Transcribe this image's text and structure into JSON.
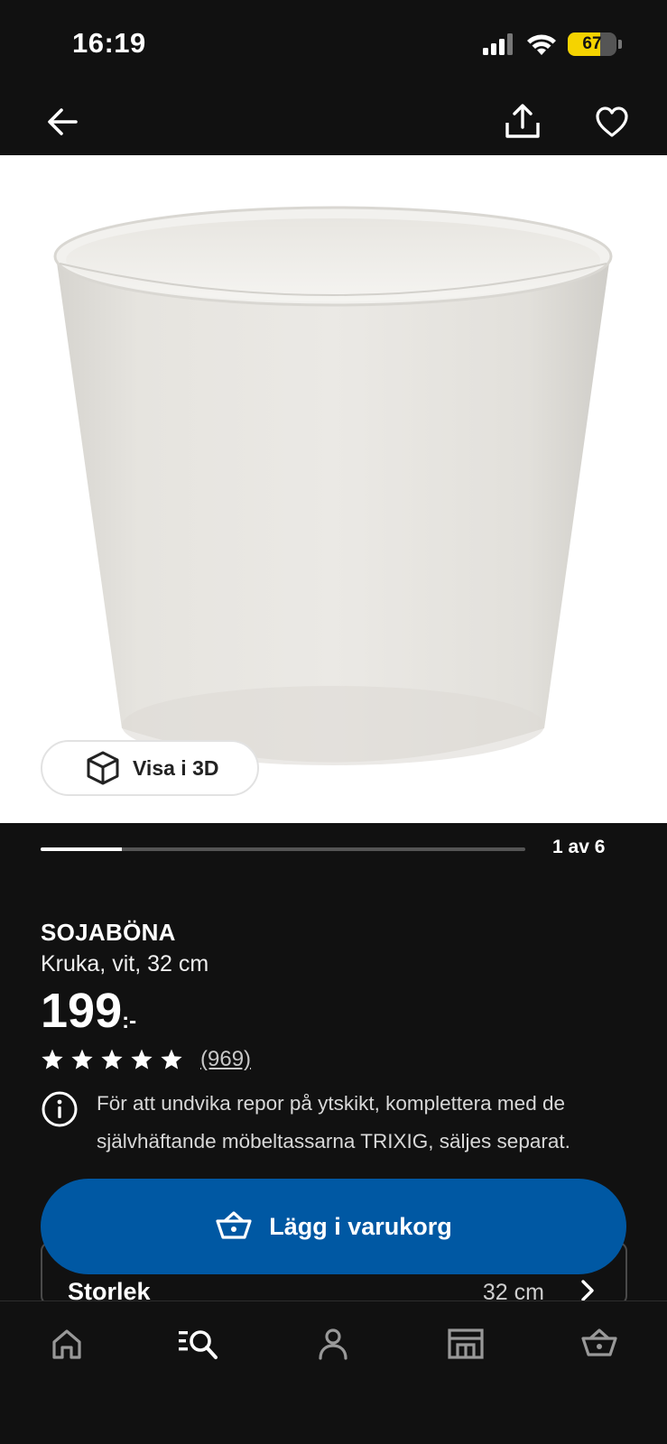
{
  "status_bar": {
    "time": "16:19",
    "battery_level": "67",
    "battery_fraction": 0.67
  },
  "nav": {
    "back_icon": "arrow-left-icon",
    "share_icon": "share-icon",
    "favorite_icon": "heart-icon"
  },
  "product": {
    "image_icon": "product-photo",
    "view_3d_label": "Visa i 3D",
    "carousel_counter": "1 av 6",
    "carousel_progress": 0.167,
    "name": "SOJABÖNA",
    "description": "Kruka, vit, 32 cm",
    "price": "199",
    "price_suffix": ":-",
    "rating_stars": 5,
    "review_count": "(969)",
    "info_note": "För att undvika repor på ytskikt, komplettera med de självhäftande möbeltassarna TRIXIG, säljes separat."
  },
  "size_selector": {
    "label": "Storlek",
    "value": "32 cm"
  },
  "cart_button": {
    "label": "Lägg i varukorg",
    "color": "#0058a3"
  },
  "tab_bar": {
    "items": [
      {
        "icon": "home-icon"
      },
      {
        "icon": "search-icon"
      },
      {
        "icon": "profile-icon"
      },
      {
        "icon": "store-icon"
      },
      {
        "icon": "basket-icon"
      }
    ]
  }
}
